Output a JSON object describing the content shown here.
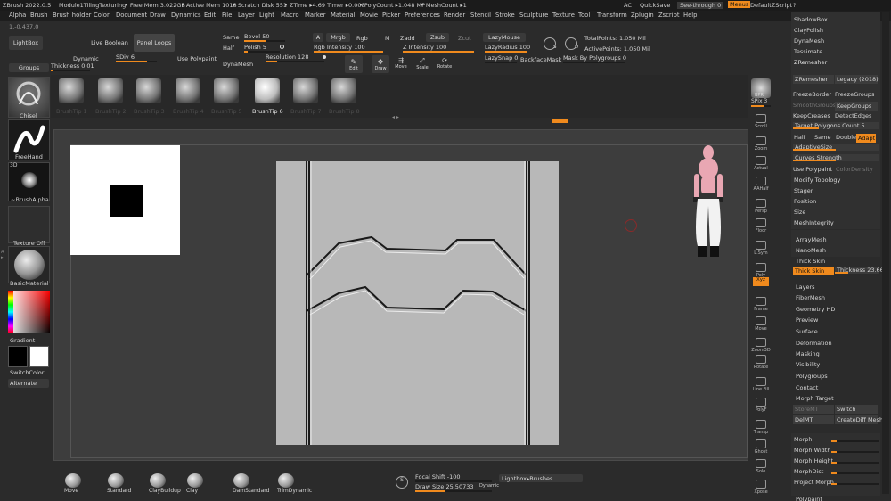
{
  "title_bar": {
    "app": "ZBrush 2022.0.5",
    "project": "Module1TilingTexturing",
    "free_mem": "• Free Mem 3.022GB",
    "active_mem": "• Active Mem 1018",
    "scratch": "• Scratch Disk 551",
    "ztime": "• ZTime ▸4.69 Timer ▸0.008",
    "polycount": "• PolyCount ▸1.048 MP",
    "meshcount": "• MeshCount ▸1",
    "ac": "AC",
    "quicksave": "QuickSave",
    "seethrough": "See-through  0",
    "menus": "Menus",
    "zscript": "DefaultZScript"
  },
  "menu": [
    "Alpha",
    "Brush",
    "Brush holder",
    "Color",
    "Document",
    "Draw",
    "Dynamics",
    "Edit",
    "File",
    "Layer",
    "Light",
    "Macro",
    "Marker",
    "Material",
    "Movie",
    "Picker",
    "Preferences",
    "Render",
    "Stencil",
    "Stroke",
    "Sculpture",
    "Texture",
    "Tool",
    "Transform",
    "Zplugin",
    "Zscript",
    "Help"
  ],
  "coords": "1,-0.437,0",
  "top_shelf": {
    "lightbox": "LightBox",
    "live_boolean": "Live Boolean",
    "panel_loops": "Panel Loops",
    "same": "Same",
    "bevel": "Bevel",
    "bevel_val": "50",
    "half": "Half",
    "polish": "Polish",
    "polish_val": "5",
    "a_btn": "A",
    "mrgb": "Mrgb",
    "rgb": "Rgb",
    "m": "M",
    "zadd": "Zadd",
    "zsub": "Zsub",
    "zcut": "Zcut",
    "lazymouse": "LazyMouse",
    "rgb_intensity": "Rgb Intensity 100",
    "z_intensity": "Z Intensity 100",
    "lazyradius": "LazyRadius 100",
    "s_label": "S",
    "d_label": "D",
    "total_points": "TotalPoints: 1.050 Mil",
    "active_points": "ActivePoints: 1.050 Mil",
    "groups": "Groups",
    "thickness": "Thickness",
    "thickness_val": "0.01",
    "dynamic": "Dynamic",
    "sdiv": "SDiv",
    "sdiv_val": "6",
    "use_polypaint": "Use Polypaint",
    "dynamesh": "DynaMesh",
    "resolution": "Resolution",
    "resolution_val": "128",
    "edit": "Edit",
    "draw": "Draw",
    "move": "Move",
    "scale": "Scale",
    "rotate": "Rotate",
    "lazysnap": "LazySnap",
    "lazysnap_val": "0",
    "backfacemask": "BackfaceMask",
    "mask_by_polygroups": "Mask By Polygroups",
    "mask_by_polygroups_val": "0"
  },
  "brushtips": [
    "BrushTip 1",
    "BrushTip 2",
    "BrushTip 3",
    "BrushTip 4",
    "BrushTip 5",
    "BrushTip 6",
    "BrushTip 7",
    "BrushTip 8"
  ],
  "left_shelf": {
    "chisel": "Chisel",
    "freehand": "FreeHand",
    "brush_alpha": "~BrushAlpha",
    "three_d": "3D",
    "texture_off": "Texture Off",
    "basic_material": "BasicMaterial",
    "gradient": "Gradient",
    "switch_color": "SwitchColor",
    "alternate": "Alternate"
  },
  "right_tools": [
    "BPR",
    "SPix 3",
    "Scroll",
    "Zoom",
    "Actual",
    "AAHalf",
    "Persp",
    "Floor",
    "L.Sym",
    "Poly",
    "Xyz",
    "Frame",
    "Move",
    "Zoom3D",
    "Rotate",
    "Line Fill",
    "PolyF",
    "Transp",
    "Ghost",
    "Solo",
    "Xpose"
  ],
  "right_panel": {
    "shadowbox": "ShadowBox",
    "claypolish": "ClayPolish",
    "dynamesh": "DynaMesh",
    "tessimate": "Tessimate",
    "zremesher_section": "ZRemesher",
    "zremesher": "ZRemesher",
    "legacy": "Legacy (2018)",
    "freezeborder": "FreezeBorder",
    "freezegroups": "FreezeGroups",
    "smoothgroups": "SmoothGroups",
    "keepgroups": "KeepGroups",
    "keepcreases": "KeepCreases",
    "detectedges": "DetectEdges",
    "target_poly": "Target Polygons Count 5",
    "half": "Half",
    "same": "Same",
    "double": "Double",
    "adapt": "Adapt",
    "adaptive_size": "AdaptiveSize",
    "adaptive_size_val": "50",
    "curves_strength": "Curves Strength",
    "curves_strength_val": "50",
    "use_polypaint": "Use Polypaint",
    "color_density": "ColorDensity",
    "modify_topology": "Modify Topology",
    "stager": "Stager",
    "position": "Position",
    "size": "Size",
    "meshintegrity": "MeshIntegrity",
    "arraymesh": "ArrayMesh",
    "nanomesh": "NanoMesh",
    "thick_skin_header": "Thick Skin",
    "thick_skin_btn": "Thick Skin",
    "thickness": "Thickness 23.66",
    "layers": "Layers",
    "fibermesh": "FiberMesh",
    "geometry_hd": "Geometry HD",
    "preview": "Preview",
    "surface": "Surface",
    "deformation": "Deformation",
    "masking": "Masking",
    "visibility": "Visibility",
    "polygroups": "Polygroups",
    "contact": "Contact",
    "morph_target": "Morph Target",
    "storemt": "StoreMT",
    "switch": "Switch",
    "delmt": "DelMT",
    "create_diff_mesh": "CreateDiff Mesh",
    "morph": "Morph",
    "morph_width": "Morph Width",
    "morph_height": "Morph Height",
    "morph_dist": "MorphDist",
    "project_morph": "Project Morph",
    "polypaint": "Polypaint"
  },
  "bottom_shelf": {
    "brushes": [
      "Move",
      "Standard",
      "ClayBuildup",
      "Clay",
      "DamStandard",
      "TrimDynamic"
    ],
    "focal_shift": "Focal Shift",
    "focal_shift_val": "-100",
    "draw_size": "Draw Size",
    "draw_size_val": "25.50733",
    "dynamic": "Dynamic",
    "lightbox_brushes": "Lightbox▸Brushes"
  },
  "colors": {
    "accent": "#f08a1d",
    "bg": "#2b2b2b",
    "canvas": "#3b3b3b",
    "tile": "#b9b9b9"
  }
}
